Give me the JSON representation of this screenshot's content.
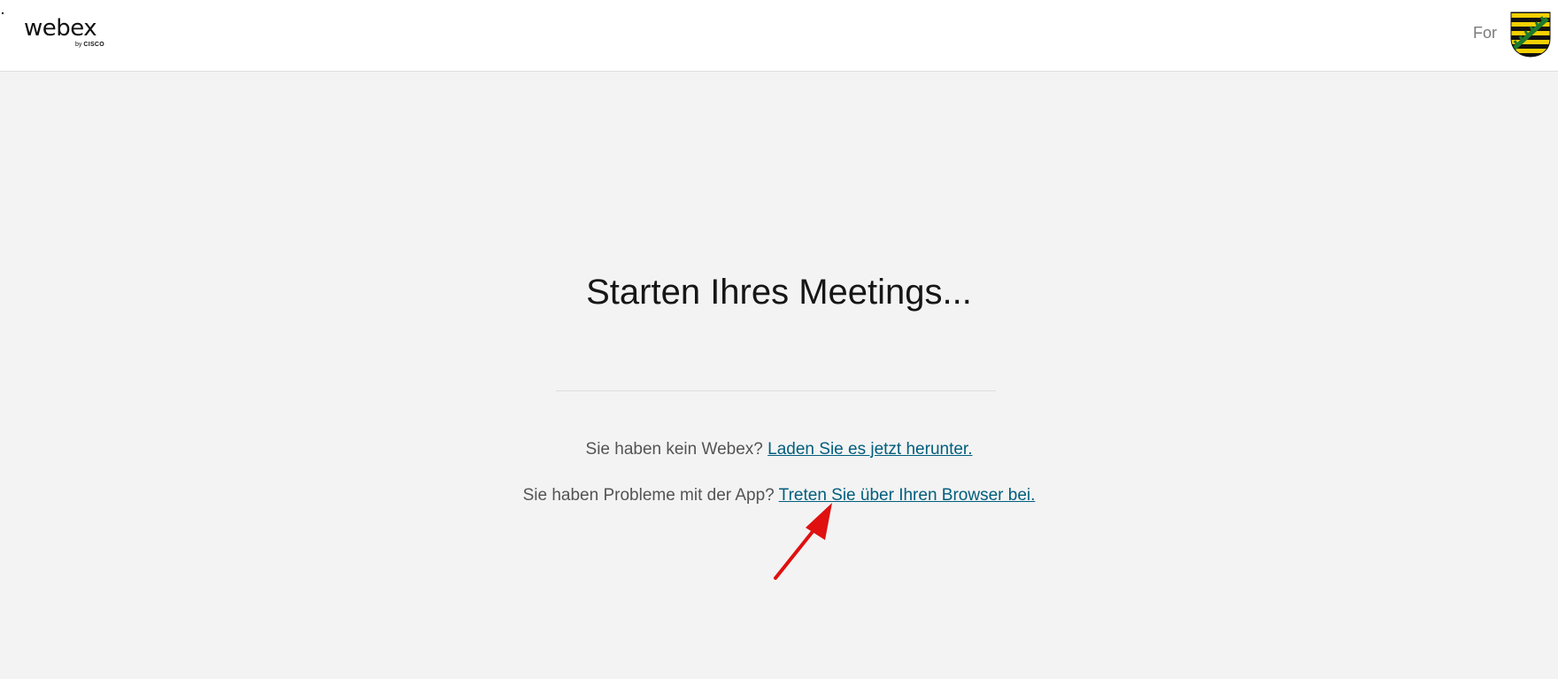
{
  "header": {
    "logo": {
      "word": "webex",
      "by": "by",
      "brand": "CISCO"
    },
    "org_prefix": "For",
    "crest_icon": "saxony-coat-of-arms",
    "crest_colors": {
      "yellow": "#f5d000",
      "black": "#111111",
      "green": "#1f7a2c"
    }
  },
  "main": {
    "title": "Starten Ihres Meetings...",
    "download_prompt": "Sie haben kein Webex?",
    "download_link": "Laden Sie es jetzt herunter.",
    "browser_prompt": "Sie haben Probleme mit der App?",
    "browser_link": "Treten Sie über Ihren Browser bei."
  },
  "annotation": {
    "icon": "red-arrow-icon",
    "color": "#e01010"
  },
  "colors": {
    "link": "#005e7d",
    "background": "#f3f3f3",
    "header_bg": "#ffffff"
  }
}
